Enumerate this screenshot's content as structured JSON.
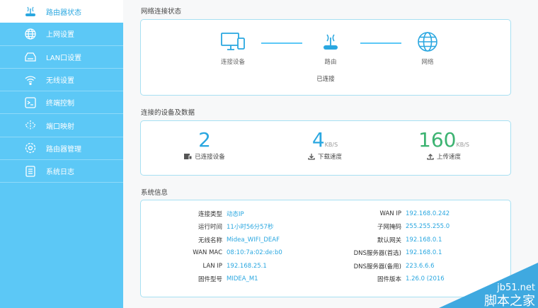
{
  "sidebar": {
    "items": [
      {
        "label": "路由器状态",
        "icon": "router-icon",
        "active": true
      },
      {
        "label": "上网设置",
        "icon": "globe-icon"
      },
      {
        "label": "LAN口设置",
        "icon": "lan-icon"
      },
      {
        "label": "无线设置",
        "icon": "wifi-icon"
      },
      {
        "label": "终端控制",
        "icon": "terminal-icon"
      },
      {
        "label": "端口映射",
        "icon": "port-mapping-icon"
      },
      {
        "label": "路由器管理",
        "icon": "gear-icon"
      },
      {
        "label": "系统日志",
        "icon": "log-icon"
      }
    ]
  },
  "network": {
    "title": "网络连接状态",
    "device": "连接设备",
    "router": "路由",
    "internet": "网络",
    "status": "已连接"
  },
  "devices": {
    "title": "连接的设备及数据",
    "count": "2",
    "count_label": "已连接设备",
    "down": "4",
    "down_unit": "KB/S",
    "down_label": "下载速度",
    "up": "160",
    "up_unit": "KB/S",
    "up_label": "上传速度"
  },
  "sysinfo": {
    "title": "系统信息",
    "left": [
      {
        "k": "连接类型",
        "v": "动态IP"
      },
      {
        "k": "运行时间",
        "v": "11小时56分57秒"
      },
      {
        "k": "无线名称",
        "v": "Midea_WIFI_DEAF"
      },
      {
        "k": "WAN MAC",
        "v": "08:10:7a:02:de:b0"
      },
      {
        "k": "LAN IP",
        "v": "192.168.25.1"
      },
      {
        "k": "固件型号",
        "v": "MIDEA_M1"
      }
    ],
    "right": [
      {
        "k": "WAN IP",
        "v": "192.168.0.242"
      },
      {
        "k": "子网掩码",
        "v": "255.255.255.0"
      },
      {
        "k": "默认网关",
        "v": "192.168.0.1"
      },
      {
        "k": "DNS服务器(首选)",
        "v": "192.168.0.1"
      },
      {
        "k": "DNS服务器(备用)",
        "v": "223.6.6.6"
      },
      {
        "k": "固件版本",
        "v": "1.26.0 (2016"
      }
    ]
  },
  "watermark": {
    "line1": "jb51.net",
    "line2": "脚本之家"
  },
  "colors": {
    "accent": "#5cc8f6",
    "blue": "#2aa7e0",
    "green": "#3cb371"
  }
}
